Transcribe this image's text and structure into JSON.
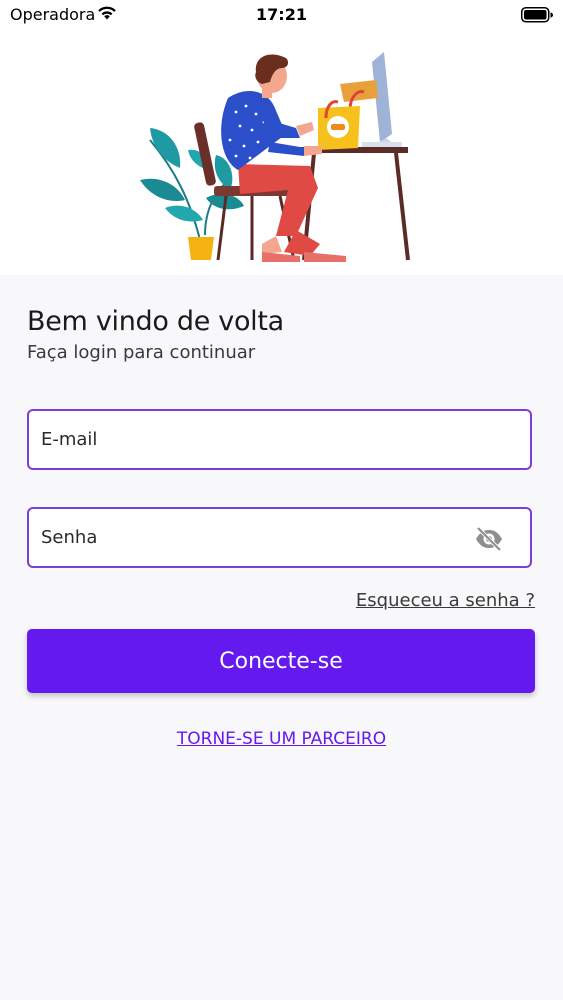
{
  "status_bar": {
    "carrier": "Operadora",
    "time": "17:21"
  },
  "login": {
    "title": "Bem vindo de volta",
    "subtitle": "Faça login para continuar",
    "email_placeholder": "E-mail",
    "password_placeholder": "Senha",
    "forgot_password": "Esqueceu a senha ?",
    "submit": "Conecte-se",
    "become_partner": "TORNE-SE UM PARCEIRO"
  },
  "colors": {
    "accent": "#6419ef",
    "field_border": "#7b3fd9",
    "background": "#f8f7fa"
  },
  "icons": {
    "password_toggle": "eye-slash-icon",
    "wifi": "wifi-icon",
    "battery": "battery-icon"
  }
}
